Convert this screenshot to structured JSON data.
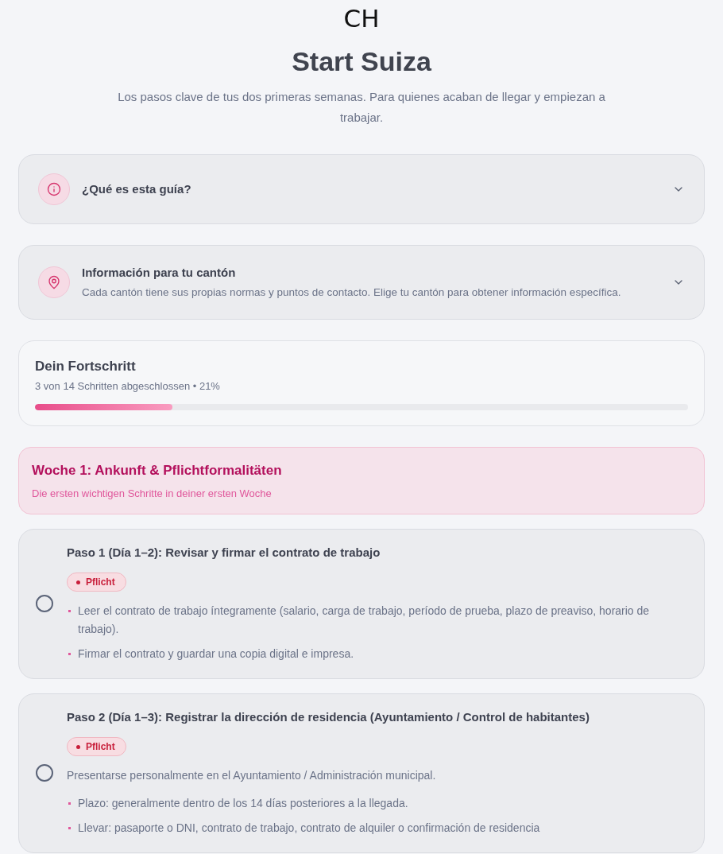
{
  "brand": {
    "label": "CH"
  },
  "header": {
    "title": "Start Suiza",
    "subtitle": "Los pasos clave de tus dos primeras semanas. Para quienes acaban de llegar y empiezan a trabajar."
  },
  "accordions": [
    {
      "title": "¿Qué es esta guía?",
      "expanded": false
    },
    {
      "title": "Información para tu cantón",
      "description": "Cada cantón tiene sus propias normas y puntos de contacto. Elige tu cantón para obtener información específica.",
      "expanded": false
    }
  ],
  "progress": {
    "title": "Dein Fortschritt",
    "summary": "3 von 14 Schritten abgeschlossen • 21%",
    "level": 0.21
  },
  "week": {
    "title": "Woche 1: Ankunft & Pflichtformalitäten",
    "subtitle": "Die ersten wichtigen Schritte in deiner ersten Woche"
  },
  "steps": [
    {
      "title": "Paso 1 (Día 1–2): Revisar y firmar el contrato de trabajo",
      "completed": false,
      "badge": {
        "label": "Pflicht",
        "kind": "required"
      },
      "items": [
        {
          "kind": "bullet",
          "text": "Leer el contrato de trabajo íntegramente (salario, carga de trabajo, período de prueba, plazo de preaviso, horario de trabajo)."
        },
        {
          "kind": "bullet",
          "text": "Firmar el contrato y guardar una copia digital e impresa."
        }
      ]
    },
    {
      "title": "Paso 2 (Día 1–3): Registrar la dirección de residencia (Ayuntamiento / Control de habitantes)",
      "completed": false,
      "badge": {
        "label": "Pflicht",
        "kind": "required"
      },
      "items": [
        {
          "kind": "text",
          "text": "Presentarse personalmente en el Ayuntamiento / Administración municipal."
        },
        {
          "kind": "bullet",
          "text": "Plazo: generalmente dentro de los 14 días posteriores a la llegada."
        },
        {
          "kind": "bullet",
          "text": "Llevar: pasaporte o DNI, contrato de trabajo, contrato de alquiler o confirmación de residencia"
        }
      ]
    }
  ]
}
